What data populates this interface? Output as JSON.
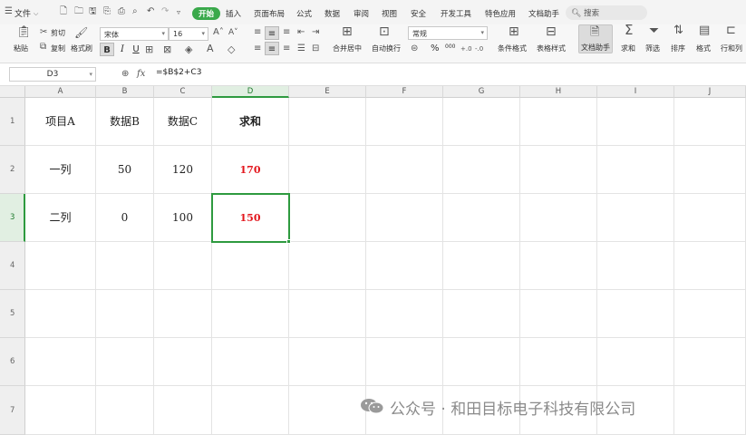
{
  "menubar": {
    "file_label": "文件",
    "tabs": [
      "开始",
      "插入",
      "页面布局",
      "公式",
      "数据",
      "审阅",
      "视图",
      "安全",
      "开发工具",
      "特色应用",
      "文档助手"
    ],
    "active_tab": "开始",
    "search_label": "搜索"
  },
  "ribbon": {
    "paste": "粘贴",
    "cut": "剪切",
    "copy": "复制",
    "format_painter": "格式刷",
    "font_name": "宋体",
    "font_size": "16",
    "bold": "B",
    "italic": "I",
    "underline": "U",
    "merge_center": "合并居中",
    "auto_wrap": "自动换行",
    "number_format": "常规",
    "percent": "%",
    "thousands": "000",
    "conditional_format": "条件格式",
    "table_style": "表格样式",
    "doc_helper": "文档助手",
    "sum": "求和",
    "filter": "筛选",
    "sort": "排序",
    "format": "格式",
    "row_col": "行和列"
  },
  "formula_bar": {
    "name_box": "D3",
    "fx": "fx",
    "formula": "=$B$2+C3"
  },
  "sheet": {
    "columns": [
      "A",
      "B",
      "C",
      "D",
      "E",
      "F",
      "G",
      "H",
      "I",
      "J"
    ],
    "rows": [
      "1",
      "2",
      "3",
      "4",
      "5",
      "6",
      "7"
    ],
    "selected_cell": "D3",
    "cells": {
      "A1": "项目A",
      "B1": "数据B",
      "C1": "数据C",
      "D1": "求和",
      "A2": "一列",
      "B2": "50",
      "C2": "120",
      "D2": "170",
      "A3": "二列",
      "B3": "0",
      "C3": "100",
      "D3": "150"
    },
    "result_color": "#e3161d",
    "selection_color": "#2e9a3f"
  },
  "watermark": "公众号 · 和田目标电子科技有限公司"
}
